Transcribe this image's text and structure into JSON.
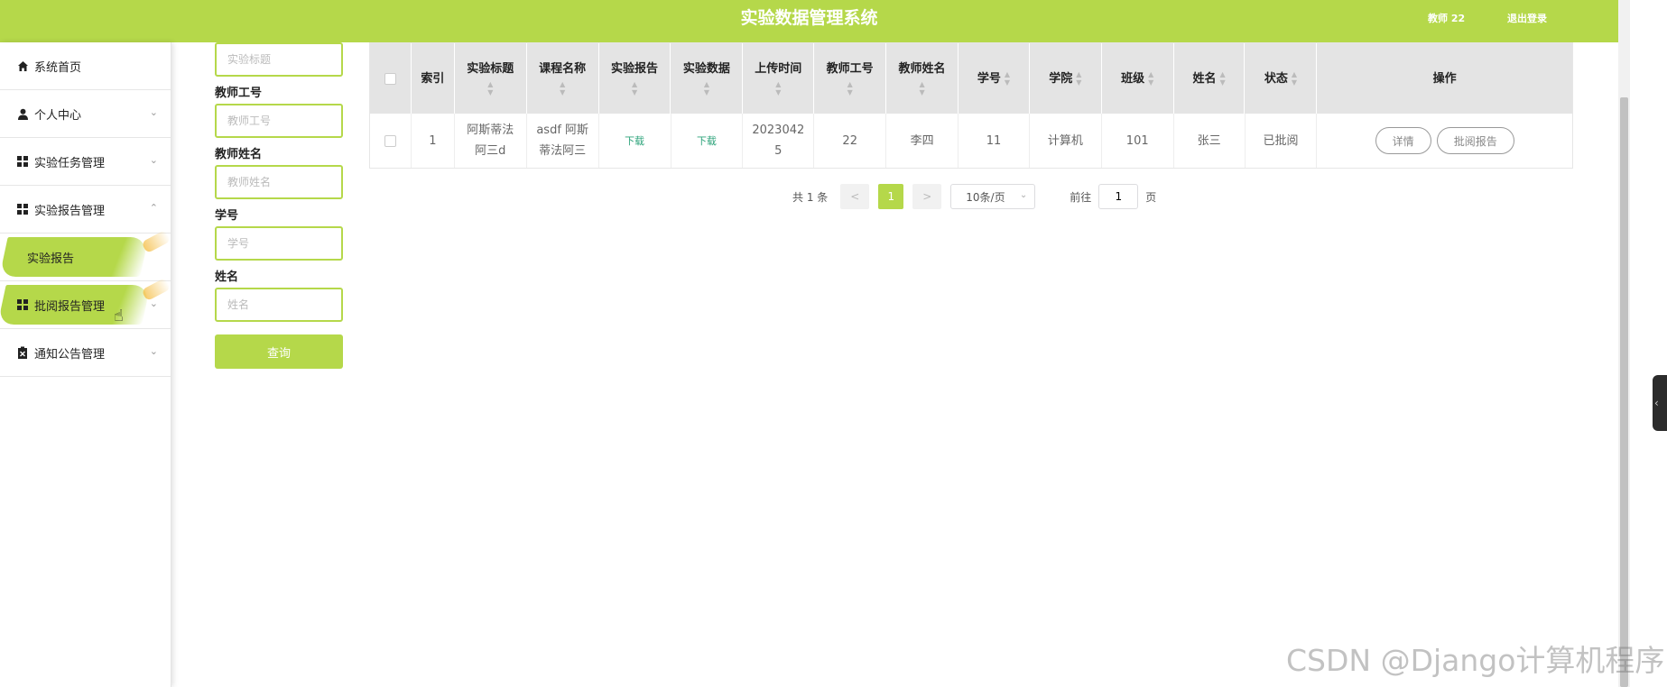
{
  "header": {
    "title": "实验数据管理系统",
    "user": "教师 22",
    "logout": "退出登录"
  },
  "sidebar": {
    "items": [
      {
        "label": "系统首页",
        "icon": "home-icon"
      },
      {
        "label": "个人中心",
        "icon": "user-icon"
      },
      {
        "label": "实验任务管理",
        "icon": "grid-icon"
      },
      {
        "label": "实验报告管理",
        "icon": "grid-icon"
      },
      {
        "label": "实验报告",
        "sub": true
      },
      {
        "label": "批阅报告管理",
        "icon": "grid-icon"
      },
      {
        "label": "通知公告管理",
        "icon": "clipboard-icon"
      }
    ]
  },
  "search": {
    "field1_placeholder": "实验标题",
    "field2_label": "教师工号",
    "field2_placeholder": "教师工号",
    "field3_label": "教师姓名",
    "field3_placeholder": "教师姓名",
    "field4_label": "学号",
    "field4_placeholder": "学号",
    "field5_label": "姓名",
    "field5_placeholder": "姓名",
    "query_button": "查询"
  },
  "table": {
    "headers": [
      "索引",
      "实验标题",
      "课程名称",
      "实验报告",
      "实验数据",
      "上传时间",
      "教师工号",
      "教师姓名",
      "学号",
      "学院",
      "班级",
      "姓名",
      "状态",
      "操作"
    ],
    "row": {
      "index": "1",
      "title_l1": "阿斯蒂法",
      "title_l2": "阿三d",
      "course_l1": "asdf 阿斯",
      "course_l2": "蒂法阿三",
      "report": "下载",
      "data": "下载",
      "time_l1": "2023042",
      "time_l2": "5",
      "teacher_id": "22",
      "teacher_name": "李四",
      "student_id": "11",
      "college": "计算机",
      "class": "101",
      "name": "张三",
      "status": "已批阅",
      "detail_btn": "详情",
      "review_btn": "批阅报告"
    }
  },
  "pagination": {
    "total": "共 1 条",
    "prev": "<",
    "current": "1",
    "next": ">",
    "page_size": "10条/页",
    "goto_label": "前往",
    "goto_value": "1",
    "page_suffix": "页"
  },
  "watermark": "CSDN @Django计算机程序"
}
